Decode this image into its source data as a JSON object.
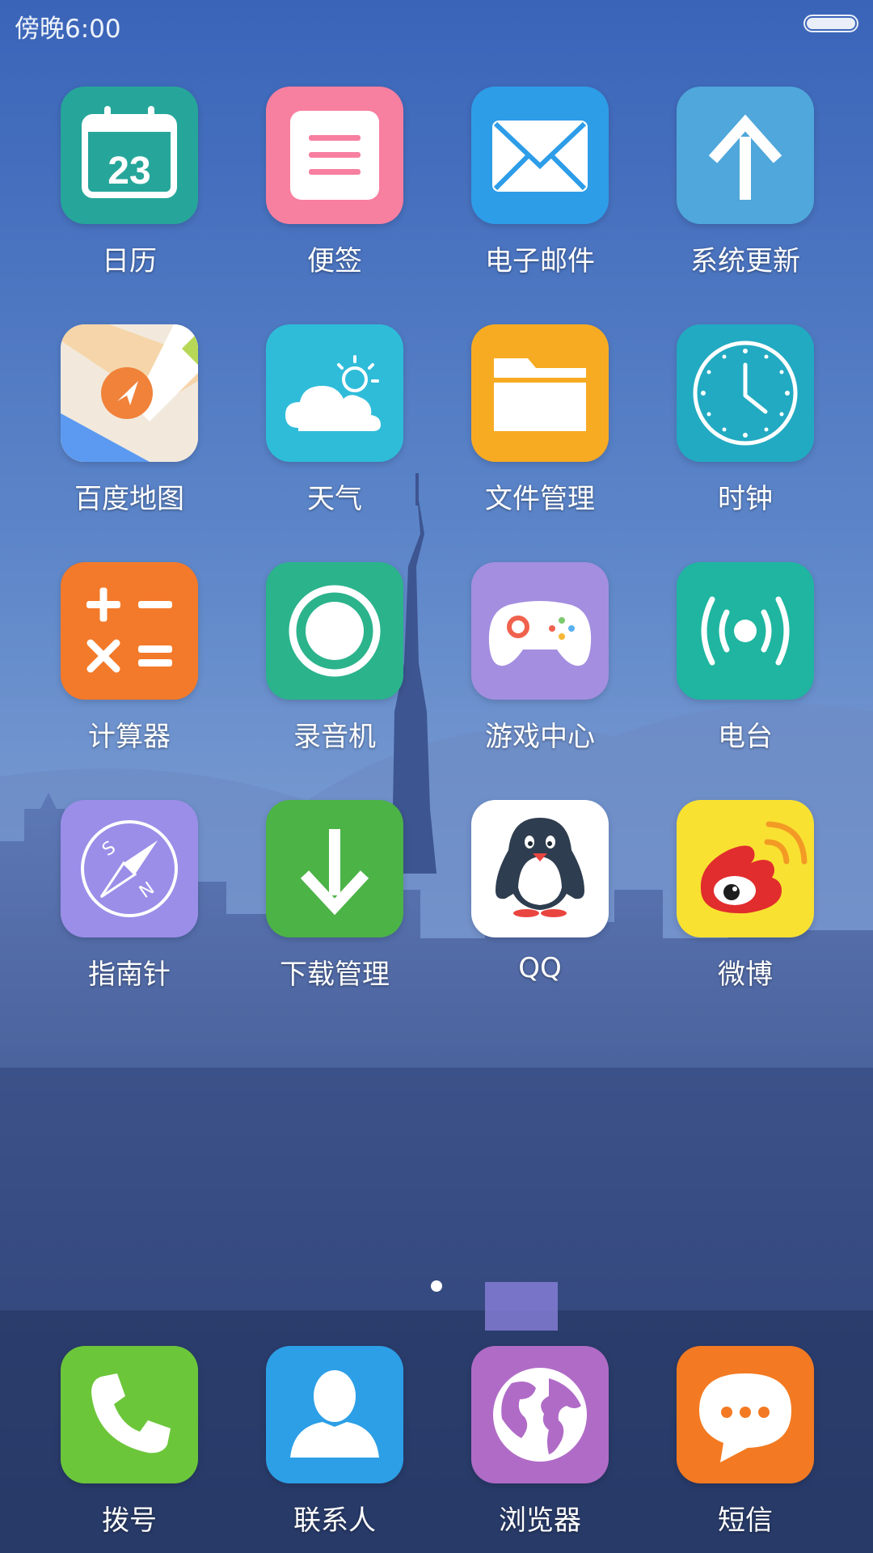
{
  "status": {
    "time": "傍晚6:00"
  },
  "apps": [
    {
      "label": "日历",
      "icon": "calendar-icon",
      "color": "#26a69a",
      "date": "23"
    },
    {
      "label": "便签",
      "icon": "notes-icon",
      "color": "#f77fa0"
    },
    {
      "label": "电子邮件",
      "icon": "mail-icon",
      "color": "#2e9de8"
    },
    {
      "label": "系统更新",
      "icon": "update-arrow-icon",
      "color": "#4fa7db"
    },
    {
      "label": "百度地图",
      "icon": "map-icon",
      "color": "#f2e9dc"
    },
    {
      "label": "天气",
      "icon": "weather-cloud-sun-icon",
      "color": "#2fbcd9"
    },
    {
      "label": "文件管理",
      "icon": "folder-icon",
      "color": "#f7ab23"
    },
    {
      "label": "时钟",
      "icon": "clock-icon",
      "color": "#22aac2"
    },
    {
      "label": "计算器",
      "icon": "calculator-icon",
      "color": "#f37a2a"
    },
    {
      "label": "录音机",
      "icon": "recorder-icon",
      "color": "#2bb38c"
    },
    {
      "label": "游戏中心",
      "icon": "gamepad-icon",
      "color": "#a48ee0"
    },
    {
      "label": "电台",
      "icon": "radio-broadcast-icon",
      "color": "#1fb5a0"
    },
    {
      "label": "指南针",
      "icon": "compass-icon",
      "color": "#9a8ee8"
    },
    {
      "label": "下载管理",
      "icon": "download-arrow-icon",
      "color": "#4cb347"
    },
    {
      "label": "QQ",
      "icon": "qq-penguin-icon",
      "color": "#ffffff"
    },
    {
      "label": "微博",
      "icon": "weibo-icon",
      "color": "#f9e132"
    }
  ],
  "dock": [
    {
      "label": "拨号",
      "icon": "phone-icon",
      "color": "#6cc63a"
    },
    {
      "label": "联系人",
      "icon": "contact-person-icon",
      "color": "#2c9fe6"
    },
    {
      "label": "浏览器",
      "icon": "globe-icon",
      "color": "#b06bc7"
    },
    {
      "label": "短信",
      "icon": "message-bubble-icon",
      "color": "#f37a22"
    }
  ]
}
